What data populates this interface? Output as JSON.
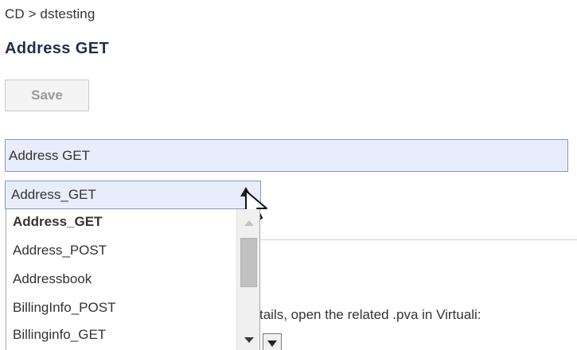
{
  "breadcrumb": "CD > dstesting",
  "page": {
    "title": "Address GET"
  },
  "toolbar": {
    "save_label": "Save"
  },
  "form": {
    "name_value": "Address GET",
    "select_value": "Address_GET",
    "help_text": "tails, open the related .pva in Virtuali:"
  },
  "dropdown": {
    "options": [
      {
        "label": "Address_GET",
        "selected": true
      },
      {
        "label": "Address_POST",
        "selected": false
      },
      {
        "label": "Addressbook",
        "selected": false
      },
      {
        "label": "BillingInfo_POST",
        "selected": false
      },
      {
        "label": "Billinginfo_GET",
        "selected": false
      }
    ]
  },
  "icons": {
    "select_arrow": "caret-up-icon",
    "cursor": "mouse-pointer-icon",
    "scroll_up": "scroll-up-arrow-icon",
    "scroll_down": "scroll-down-arrow-icon",
    "mini_dropdown": "caret-down-icon"
  },
  "colors": {
    "title": "#1f2f4a",
    "input_background": "#e9edfb",
    "input_border": "#8899bb",
    "disabled_text": "#9a9a9a"
  }
}
